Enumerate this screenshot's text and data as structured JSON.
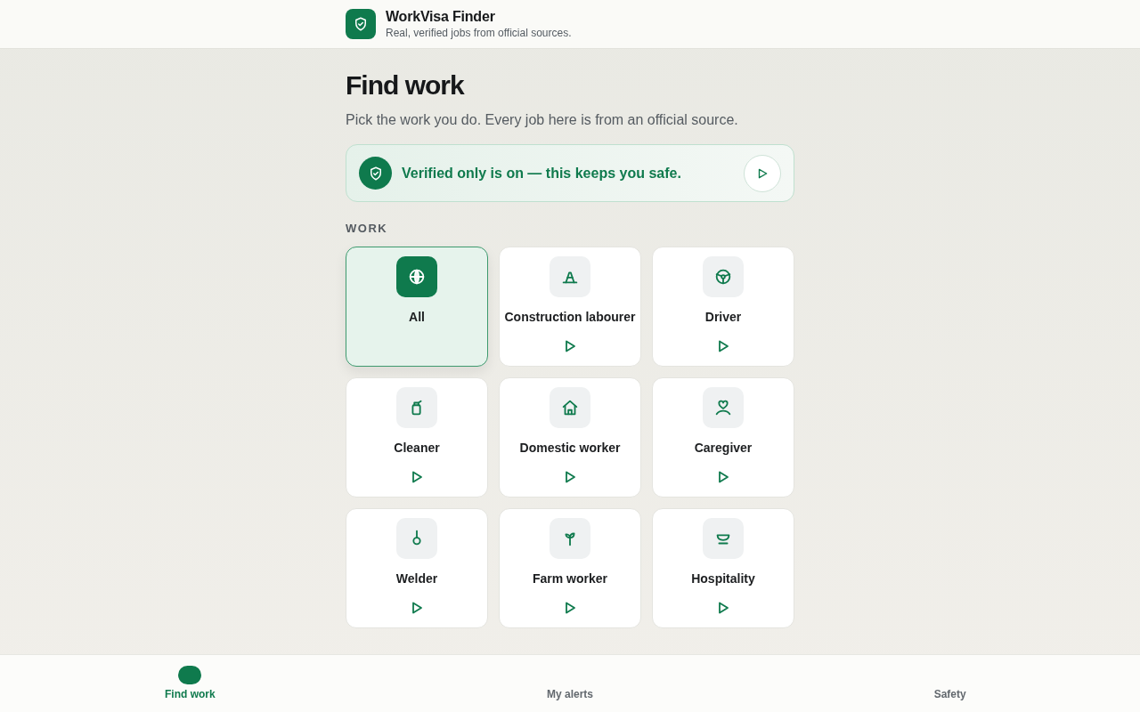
{
  "header": {
    "title": "WorkVisa Finder",
    "subtitle": "Real, verified jobs from official sources."
  },
  "page": {
    "title": "Find work",
    "subtitle": "Pick the work you do. Every job here is from an official source."
  },
  "banner": {
    "text": "Verified only is on — this keeps you safe.",
    "on": true
  },
  "section_label": "WORK",
  "categories": [
    {
      "label": "All",
      "kind": "globe",
      "selected": true
    },
    {
      "label": "Construction labourer",
      "kind": "cone",
      "selected": false
    },
    {
      "label": "Driver",
      "kind": "wheel",
      "selected": false
    },
    {
      "label": "Cleaner",
      "kind": "bottle",
      "selected": false
    },
    {
      "label": "Domestic worker",
      "kind": "house",
      "selected": false
    },
    {
      "label": "Caregiver",
      "kind": "care",
      "selected": false
    },
    {
      "label": "Welder",
      "kind": "torch",
      "selected": false
    },
    {
      "label": "Farm worker",
      "kind": "sprout",
      "selected": false
    },
    {
      "label": "Hospitality",
      "kind": "bowl",
      "selected": false
    }
  ],
  "nav": [
    {
      "label": "Find work",
      "selected": true
    },
    {
      "label": "My alerts",
      "selected": false
    },
    {
      "label": "Safety",
      "selected": false
    }
  ]
}
